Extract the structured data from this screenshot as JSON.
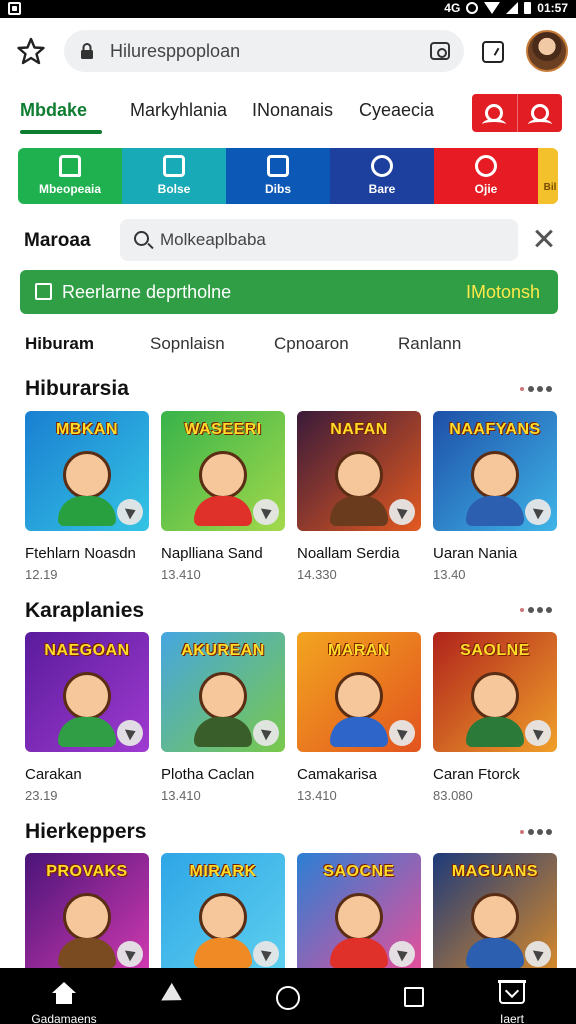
{
  "status_bar": {
    "right_text": "4G",
    "time": "01:57"
  },
  "browser": {
    "url": "Hiluresppoploan",
    "profile": {
      "initials": ""
    }
  },
  "main_tabs": [
    {
      "label": "Mbdake"
    },
    {
      "label": "Markyhlania"
    },
    {
      "label": "INonanais"
    },
    {
      "label": "Cyeaecia"
    }
  ],
  "categories": [
    {
      "label": "Mbeopeaia",
      "color": "#1fb14f"
    },
    {
      "label": "Bolse",
      "color": "#18aab6"
    },
    {
      "label": "Dibs",
      "color": "#0b58b7"
    },
    {
      "label": "Bare",
      "color": "#1d3f9e"
    },
    {
      "label": "Ojie",
      "color": "#e71b24"
    },
    {
      "label": "Bil",
      "color": "#f2c12b"
    }
  ],
  "search": {
    "label": "Maroaa",
    "placeholder": "Molkeaplbaba"
  },
  "banner": {
    "text": "Reerlarne deprtholne",
    "action": "IMotonsh"
  },
  "sub_tabs": [
    {
      "label": "Hiburam"
    },
    {
      "label": "Sopnlaisn"
    },
    {
      "label": "Cpnoaron"
    },
    {
      "label": "Ranlann"
    }
  ],
  "sections": [
    {
      "title": "Hiburarsia",
      "cards": [
        {
          "banner": "MBKAN",
          "title": "Ftehlarn Noasdn",
          "meta": "12.19",
          "bg": "linear-gradient(135deg,#1a7fd1,#35c4e5)",
          "shirt": "#28a040"
        },
        {
          "banner": "WASEERI",
          "title": "Naplliana Sand",
          "meta": "13.410",
          "bg": "linear-gradient(135deg,#37b34a,#a3d94b)",
          "shirt": "#e0302a"
        },
        {
          "banner": "NAFAN",
          "title": "Noallam Serdia",
          "meta": "14.330",
          "bg": "linear-gradient(135deg,#3a1a3a,#e35a20)",
          "shirt": "#6b3b1d"
        },
        {
          "banner": "NAAFYANS",
          "title": "Uaran Nania",
          "meta": "13.40",
          "bg": "linear-gradient(135deg,#1e4fa8,#3fb5e8)",
          "shirt": "#2c5fb0"
        }
      ]
    },
    {
      "title": "Karaplanies",
      "cards": [
        {
          "banner": "NAEGOAN",
          "title": "Carakan",
          "meta": "23.19",
          "bg": "linear-gradient(135deg,#5a1b9c,#a03bd1)",
          "shirt": "#2f9e44"
        },
        {
          "banner": "AKUREAN",
          "title": "Plotha Caclan",
          "meta": "13.410",
          "bg": "linear-gradient(135deg,#46a6e0,#79c94a)",
          "shirt": "#3a5e2a"
        },
        {
          "banner": "MARAN",
          "title": "Camakarisa",
          "meta": "13.410",
          "bg": "linear-gradient(135deg,#f2a51f,#e2531f)",
          "shirt": "#2d66c8"
        },
        {
          "banner": "SAOLNE",
          "title": "Caran Ftorck",
          "meta": "83.080",
          "bg": "linear-gradient(135deg,#b0231c,#f0a02a)",
          "shirt": "#2c7a3a"
        }
      ]
    },
    {
      "title": "Hierkeppers",
      "cards": [
        {
          "banner": "PROVAKS",
          "title": "",
          "meta": "",
          "bg": "linear-gradient(135deg,#4a1479,#d13ab0)",
          "shirt": "#7a4a20"
        },
        {
          "banner": "MIRARK",
          "title": "",
          "meta": "",
          "bg": "linear-gradient(135deg,#2ea6e6,#5fd0ef)",
          "shirt": "#f08a24"
        },
        {
          "banner": "SAOCNE",
          "title": "",
          "meta": "",
          "bg": "linear-gradient(135deg,#2b7fd4,#e84f9a)",
          "shirt": "#e0302a"
        },
        {
          "banner": "MAGUANS",
          "title": "",
          "meta": "",
          "bg": "linear-gradient(135deg,#1d3a7a,#d88a2a)",
          "shirt": "#2c5fb0"
        }
      ]
    }
  ],
  "bottom_nav": {
    "home_label": "Gadamaens",
    "downloads_label": "Iaert"
  }
}
